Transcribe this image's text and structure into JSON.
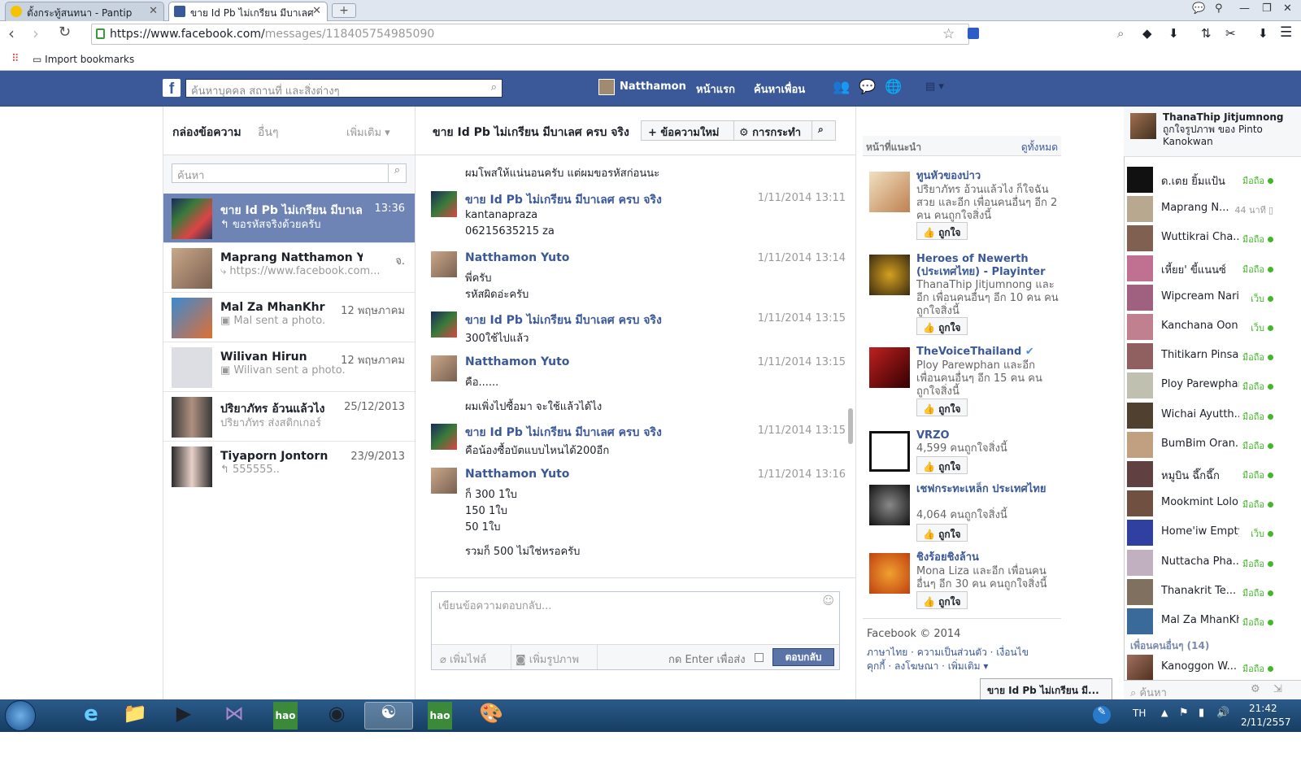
{
  "browser": {
    "tabs": [
      {
        "title": "ตั้งกระทู้สนทนา - Pantip"
      },
      {
        "title": "ขาย Id Pb ไม่เกรียน มีบาเลศ"
      }
    ],
    "url_host": "https://www.facebook.com/",
    "url_path": "messages/118405754985090",
    "bookmark": "Import bookmarks"
  },
  "fb": {
    "search_placeholder": "ค้นหาบุคคล สถานที่ และสิ่งต่างๆ",
    "user": "Natthamon",
    "home": "หน้าแรก",
    "find_friends": "ค้นหาเพื่อน"
  },
  "inbox": {
    "title": "กล่องข้อความ",
    "other": "อื่นๆ",
    "more": "เพิ่มเติม ▾",
    "search_placeholder": "ค้นหา",
    "conversations": [
      {
        "name": "ขาย Id Pb ไม่เกรียน มีบาเลศ",
        "date": "13:36",
        "snippet": "↰ ขอรหัสจริงด้วยครับ"
      },
      {
        "name": "Maprang Natthamon Yuto",
        "date": "จ.",
        "snippet": "⤷ https://www.facebook.com..."
      },
      {
        "name": "Mal Za MhanKhr",
        "date": "12 พฤษภาคม",
        "snippet": "▣ Mal sent a photo."
      },
      {
        "name": "Wilivan Hirun",
        "date": "12 พฤษภาคม",
        "snippet": "▣ Wilivan sent a photo."
      },
      {
        "name": "ปริยาภัทร อ้วนแล้วไง",
        "date": "25/12/2013",
        "snippet": "ปริยาภัทร ส่งสติกเกอร์"
      },
      {
        "name": "Tiyaporn Jontorn",
        "date": "23/9/2013",
        "snippet": "↰ 555555.."
      }
    ]
  },
  "thread": {
    "title": "ขาย Id Pb ไม่เกรียน มีบาเลศ ครบ จริง",
    "new_msg": "+ ข้อความใหม่",
    "actions": "⚙ การกระทำ",
    "top_line": "ผมโพสให้แน่นอนครับ แต่ผมขอรหัสก่อนนะ",
    "messages": [
      {
        "name": "ขาย Id Pb ไม่เกรียน มีบาเลศ ครบ จริง",
        "time": "1/11/2014 13:11",
        "lines": [
          "kantanapraza",
          "06215635215 za"
        ]
      },
      {
        "name": "Natthamon Yuto",
        "time": "1/11/2014 13:14",
        "lines": [
          "พี่ครับ",
          "รหัสผิดอ่ะครับ"
        ]
      },
      {
        "name": "ขาย Id Pb ไม่เกรียน มีบาเลศ ครบ จริง",
        "time": "1/11/2014 13:15",
        "lines": [
          "300ใช้ไปแล้ว"
        ]
      },
      {
        "name": "Natthamon Yuto",
        "time": "1/11/2014 13:15",
        "lines": [
          "คือ......",
          "",
          "ผมเพิ่งไปซื้อมา จะใช้แล้วได้ไง"
        ]
      },
      {
        "name": "ขาย Id Pb ไม่เกรียน มีบาเลศ ครบ จริง",
        "time": "1/11/2014 13:15",
        "lines": [
          "คือน้องซื้อบัตแบบไหนได้200อีก"
        ]
      },
      {
        "name": "Natthamon Yuto",
        "time": "1/11/2014 13:16",
        "lines": [
          "ก็ 300 1ใบ",
          "150 1ใบ",
          "50 1ใบ",
          "",
          "รวมก็ 500 ไม่ใช่หรอครับ"
        ]
      }
    ],
    "reply_placeholder": "เขียนข้อความตอบกลับ...",
    "add_file": "เพิ่มไฟล์",
    "add_photo": "เพิ่มรูปภาพ",
    "enter_send": "กด Enter เพื่อส่ง",
    "reply_btn": "ตอบกลับ"
  },
  "suggest": {
    "title": "หน้าที่แนะนำ",
    "see_all": "ดูทั้งหมด",
    "like": "ถูกใจ",
    "pages": [
      {
        "name": "ทูนหัวของบ่าว",
        "desc": "ปริยาภัทร อ้วนแล้วไง ก็ใจฉันสวย และอีก เพื่อนคนอื่นๆ อีก 2 คน คนถูกใจสิ่งนี้"
      },
      {
        "name": "Heroes of Newerth (ประเทศไทย) - Playinter",
        "desc": "ThanaThip Jitjumnong และอีก เพื่อนคนอื่นๆ อีก 10 คน คนถูกใจสิ่งนี้"
      },
      {
        "name": "TheVoiceThailand",
        "desc": "Ploy Parewphan และอีก เพื่อนคนอื่นๆ อีก 15 คน คนถูกใจสิ่งนี้"
      },
      {
        "name": "VRZO",
        "desc": "4,599 คนถูกใจสิ่งนี้"
      },
      {
        "name": "เชฟกระทะเหล็ก ประเทศไทย",
        "desc": "4,064 คนถูกใจสิ่งนี้"
      },
      {
        "name": "ชิงร้อยชิงล้าน",
        "desc": "Mona Liza และอีก เพื่อนคนอื่นๆ อีก 30 คน คนถูกใจสิ่งนี้"
      }
    ],
    "footer_copy": "Facebook © 2014",
    "footer_links1": "ภาษาไทย · ความเป็นส่วนตัว · เงื่อนไข",
    "footer_links2": "คุกกี้ · ลงโฆษณา · เพิ่มเติม ▾"
  },
  "ticker": {
    "name": "ThanaThip Jitjumnong",
    "action": "ถูกใจรูปภาพ ของ Pinto Kanokwan"
  },
  "chat": {
    "friends": [
      {
        "name": "ด.เตย ยิ้มแป้น",
        "status": "มือถือ"
      },
      {
        "name": "Maprang N...",
        "status": "44 นาที"
      },
      {
        "name": "Wuttikrai Cha...",
        "status": "มือถือ"
      },
      {
        "name": "เหี้ยย' ขี้แนนซ์",
        "status": "มือถือ"
      },
      {
        "name": "Wipcream Naris...",
        "status": "เว็บ"
      },
      {
        "name": "Kanchana Oon ...",
        "status": "เว็บ"
      },
      {
        "name": "Thitikarn Pinsap",
        "status": "มือถือ"
      },
      {
        "name": "Ploy Parewphan",
        "status": "มือถือ"
      },
      {
        "name": "Wichai Ayutth...",
        "status": "มือถือ"
      },
      {
        "name": "BumBim Oran...",
        "status": "มือถือ"
      },
      {
        "name": "หมูบิน ฉึ๊กฉึ๊ก",
        "status": "มือถือ"
      },
      {
        "name": "Mookmint Lolo",
        "status": "มือถือ"
      },
      {
        "name": "Home'iw Empty",
        "status": "เว็บ"
      },
      {
        "name": "Nuttacha Pha...",
        "status": "มือถือ"
      },
      {
        "name": "Thanakrit Te...",
        "status": "มือถือ"
      },
      {
        "name": "Mal Za MhanKhr",
        "status": "มือถือ"
      }
    ],
    "others_header": "เพื่อนคนอื่นๆ (14)",
    "others": [
      {
        "name": "Kanoggon W...",
        "status": "มือถือ"
      }
    ],
    "search_placeholder": "ค้นหา",
    "dock_title": "ขาย Id Pb ไม่เกรียน มี..."
  },
  "taskbar": {
    "lang": "TH",
    "time": "21:42",
    "date": "2/11/2557"
  }
}
